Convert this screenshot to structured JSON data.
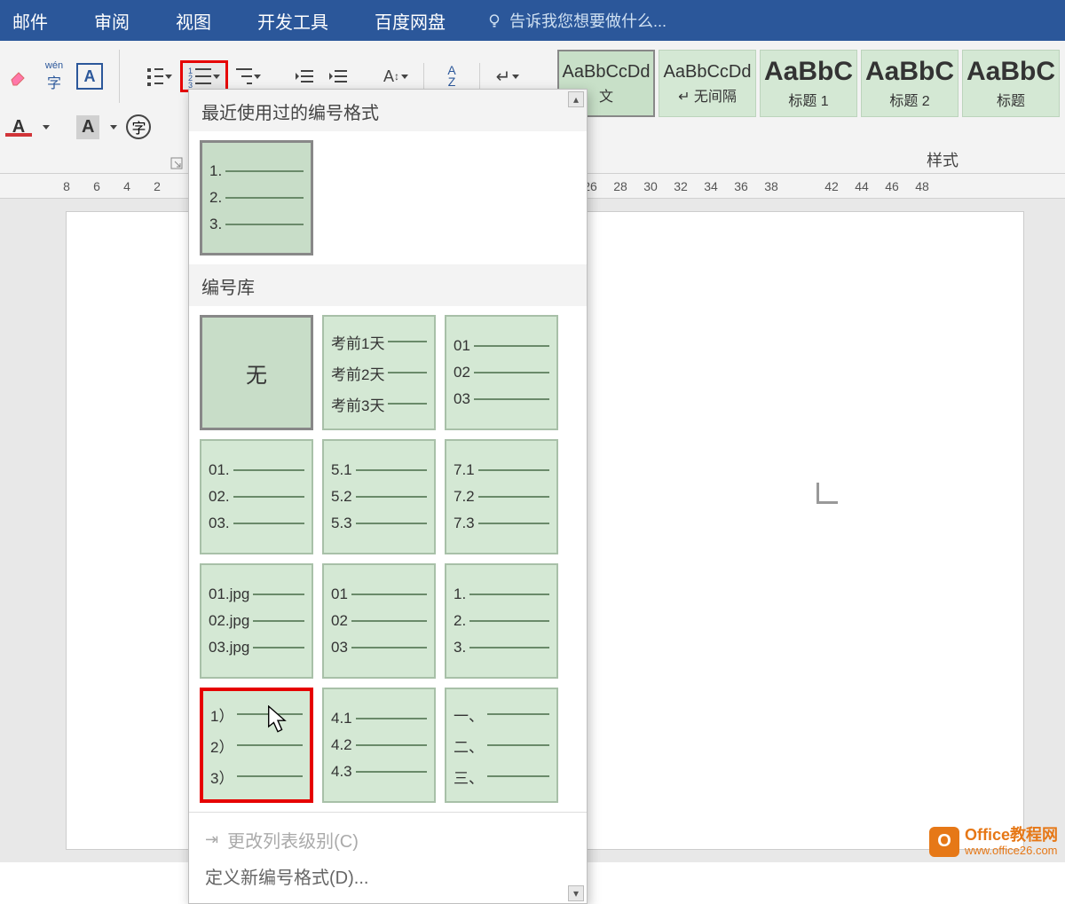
{
  "menu": {
    "mail": "邮件",
    "review": "审阅",
    "view": "视图",
    "dev": "开发工具",
    "baidu": "百度网盘",
    "tellme": "告诉我您想要做什么..."
  },
  "ribbon": {
    "wen": "wén",
    "zi": "字",
    "A": "A",
    "styles_label": "样式",
    "styles": [
      {
        "preview": "AaBbCcDd",
        "label": "文",
        "big": false,
        "sel": true
      },
      {
        "preview": "AaBbCcDd",
        "label": "↵ 无间隔",
        "big": false
      },
      {
        "preview": "AaBbC",
        "label": "标题 1",
        "big": true
      },
      {
        "preview": "AaBbC",
        "label": "标题 2",
        "big": true
      },
      {
        "preview": "AaBbC",
        "label": "标题",
        "big": true
      }
    ]
  },
  "ruler_left": [
    "8",
    "6",
    "4",
    "2"
  ],
  "ruler_right": [
    "26",
    "28",
    "30",
    "32",
    "34",
    "36",
    "38",
    "",
    "42",
    "44",
    "46",
    "48"
  ],
  "dropdown": {
    "recent_title": "最近使用过的编号格式",
    "library_title": "编号库",
    "recent": [
      [
        "1.",
        "2.",
        "3."
      ]
    ],
    "library": [
      {
        "none": "无"
      },
      {
        "rows": [
          "考前1天",
          "考前2天",
          "考前3天"
        ]
      },
      {
        "rows": [
          "01",
          "02",
          "03"
        ]
      },
      {
        "rows": [
          "01.",
          "02.",
          "03."
        ]
      },
      {
        "rows": [
          "5.1",
          "5.2",
          "5.3"
        ]
      },
      {
        "rows": [
          "7.1",
          "7.2",
          "7.3"
        ]
      },
      {
        "rows": [
          "01.jpg",
          "02.jpg",
          "03.jpg"
        ]
      },
      {
        "rows": [
          "01",
          "02",
          "03"
        ]
      },
      {
        "rows": [
          "1.",
          "2.",
          "3."
        ]
      },
      {
        "rows": [
          "1）",
          "2）",
          "3）"
        ],
        "red": true
      },
      {
        "rows": [
          "4.1",
          "4.2",
          "4.3"
        ]
      },
      {
        "rows": [
          "一、",
          "二、",
          "三、"
        ]
      }
    ],
    "change_level": "更改列表级别(C)",
    "define_new": "定义新编号格式(D)..."
  },
  "watermark": {
    "brand": "Office教程网",
    "url": "www.office26.com",
    "icon": "O"
  }
}
